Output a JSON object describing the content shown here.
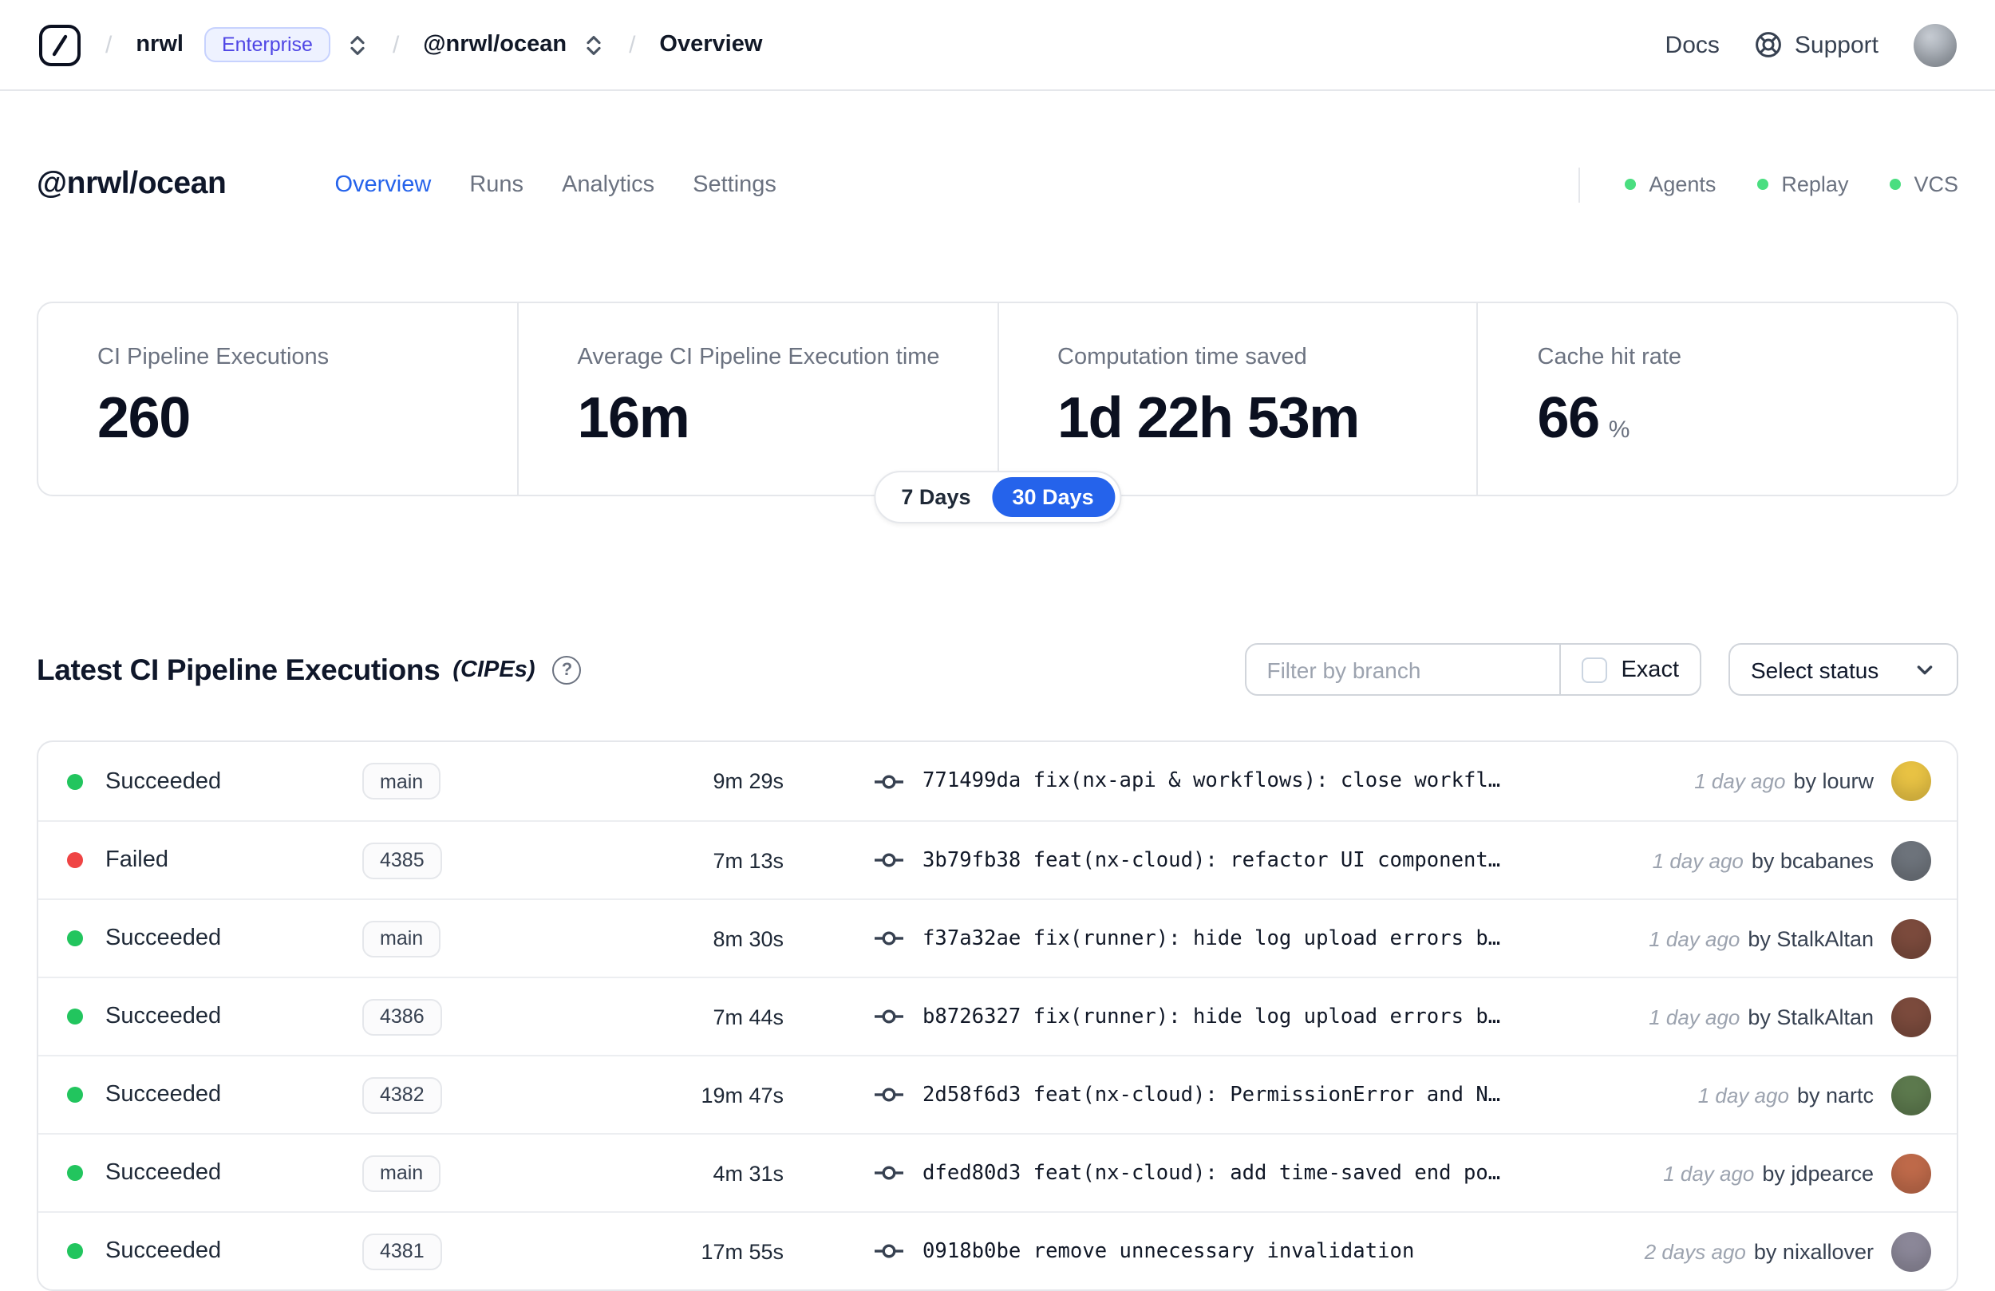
{
  "topnav": {
    "breadcrumb_separator": "/",
    "org": "nrwl",
    "org_badge": "Enterprise",
    "workspace": "@nrwl/ocean",
    "page": "Overview",
    "docs": "Docs",
    "support": "Support"
  },
  "header": {
    "title": "@nrwl/ocean",
    "tabs": [
      {
        "label": "Overview",
        "active": true
      },
      {
        "label": "Runs",
        "active": false
      },
      {
        "label": "Analytics",
        "active": false
      },
      {
        "label": "Settings",
        "active": false
      }
    ],
    "status_legend": [
      {
        "label": "Agents"
      },
      {
        "label": "Replay"
      },
      {
        "label": "VCS"
      }
    ]
  },
  "stats": {
    "cards": [
      {
        "label": "CI Pipeline Executions",
        "value": "260",
        "suffix": ""
      },
      {
        "label": "Average CI Pipeline Execution time",
        "value": "16m",
        "suffix": ""
      },
      {
        "label": "Computation time saved",
        "value": "1d 22h 53m",
        "suffix": ""
      },
      {
        "label": "Cache hit rate",
        "value": "66",
        "suffix": "%"
      }
    ],
    "range_options": [
      {
        "label": "7 Days",
        "selected": false
      },
      {
        "label": "30 Days",
        "selected": true
      }
    ]
  },
  "cipes": {
    "title": "Latest CI Pipeline Executions",
    "title_suffix": "(CIPEs)",
    "filter": {
      "placeholder": "Filter by branch",
      "exact_label": "Exact",
      "exact_checked": false
    },
    "status_select": "Select status",
    "rows": [
      {
        "status": "Succeeded",
        "status_color": "#22c55e",
        "branch": "main",
        "duration": "9m 29s",
        "commit_hash": "771499da",
        "commit_message": "fix(nx-api & workflows): close workfl…",
        "time": "1 day ago",
        "author": "by lourw",
        "avatar_color": "#e9c344"
      },
      {
        "status": "Failed",
        "status_color": "#ef4444",
        "branch": "4385",
        "duration": "7m 13s",
        "commit_hash": "3b79fb38",
        "commit_message": "feat(nx-cloud): refactor UI component…",
        "time": "1 day ago",
        "author": "by bcabanes",
        "avatar_color": "#6e747c"
      },
      {
        "status": "Succeeded",
        "status_color": "#22c55e",
        "branch": "main",
        "duration": "8m 30s",
        "commit_hash": "f37a32ae",
        "commit_message": "fix(runner): hide log upload errors b…",
        "time": "1 day ago",
        "author": "by StalkAltan",
        "avatar_color": "#7c4b3d"
      },
      {
        "status": "Succeeded",
        "status_color": "#22c55e",
        "branch": "4386",
        "duration": "7m 44s",
        "commit_hash": "b8726327",
        "commit_message": "fix(runner): hide log upload errors b…",
        "time": "1 day ago",
        "author": "by StalkAltan",
        "avatar_color": "#7c4b3d"
      },
      {
        "status": "Succeeded",
        "status_color": "#22c55e",
        "branch": "4382",
        "duration": "19m 47s",
        "commit_hash": "2d58f6d3",
        "commit_message": "feat(nx-cloud): PermissionError and N…",
        "time": "1 day ago",
        "author": "by nartc",
        "avatar_color": "#5d7a4e"
      },
      {
        "status": "Succeeded",
        "status_color": "#22c55e",
        "branch": "main",
        "duration": "4m 31s",
        "commit_hash": "dfed80d3",
        "commit_message": "feat(nx-cloud): add time-saved end po…",
        "time": "1 day ago",
        "author": "by jdpearce",
        "avatar_color": "#bf6a4a"
      },
      {
        "status": "Succeeded",
        "status_color": "#22c55e",
        "branch": "4381",
        "duration": "17m 55s",
        "commit_hash": "0918b0be",
        "commit_message": "remove unnecessary invalidation",
        "time": "2 days ago",
        "author": "by nixallover",
        "avatar_color": "#8c8899"
      }
    ]
  },
  "colors": {
    "accent": "#2563eb",
    "succeeded": "#22c55e",
    "failed": "#ef4444",
    "legend_dot": "#4ade80",
    "enterprise_badge_text": "#4f46e5"
  }
}
